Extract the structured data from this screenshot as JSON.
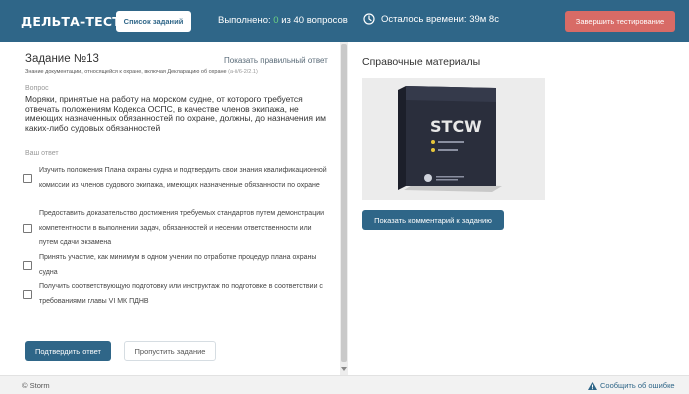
{
  "header": {
    "logo": "ДЕЛЬТА-ТЕСТ",
    "task_list_button": "Список заданий",
    "progress_prefix": "Выполнено: ",
    "progress_done": "0",
    "progress_suffix": " из 40 вопросов",
    "timer_text": "Осталось времени: 39м 8с",
    "finish_button": "Завершить тестирование"
  },
  "task": {
    "title": "Задание №13",
    "show_answer_link": "Показать правильный ответ",
    "meta": "Знание документации, относящейся к охране, включая Декларацию об охране ",
    "meta_code": "(a-ii/6-2/2.1)",
    "question_label": "Вопрос",
    "question_text": "Моряки, принятые на работу на морском судне, от которого требуется отвечать положениям Кодекса ОСПС, в качестве членов экипажа, не имеющих назначенных обязанностей по охране, должны, до назначения им каких-либо судовых обязанностей",
    "answer_label": "Ваш ответ",
    "options": [
      {
        "text": "Изучить положения Плана охраны судна и подтвердить свои знания квалификационной комиссии из членов судового экипажа, имеющих назначенные обязанности по охране"
      },
      {
        "text": "Предоставить доказательство достижения требуемых стандартов путем демонстрации компетентности в выполнении задач, обязанностей и несении ответственности или путем сдачи экзамена"
      },
      {
        "text": "Принять участие, как минимум в одном учении по отработке процедур плана охраны судна"
      },
      {
        "text": "Получить соответствующую подготовку или инструктаж по подготовке в соответствии с требованиями главы VI МК ПДНВ"
      }
    ],
    "confirm_button": "Подтвердить ответ",
    "skip_button": "Пропустить задание"
  },
  "reference": {
    "title": "Справочные материалы",
    "image_brand": "STCW",
    "comment_button": "Показать комментарий к заданию"
  },
  "footer": {
    "copyright": "© Storm",
    "report_link": "Сообщить об ошибке"
  },
  "colors": {
    "header_bg": "#2f6688",
    "accent": "#2f6688",
    "danger": "#d86b66",
    "done_count": "#6cd183"
  }
}
